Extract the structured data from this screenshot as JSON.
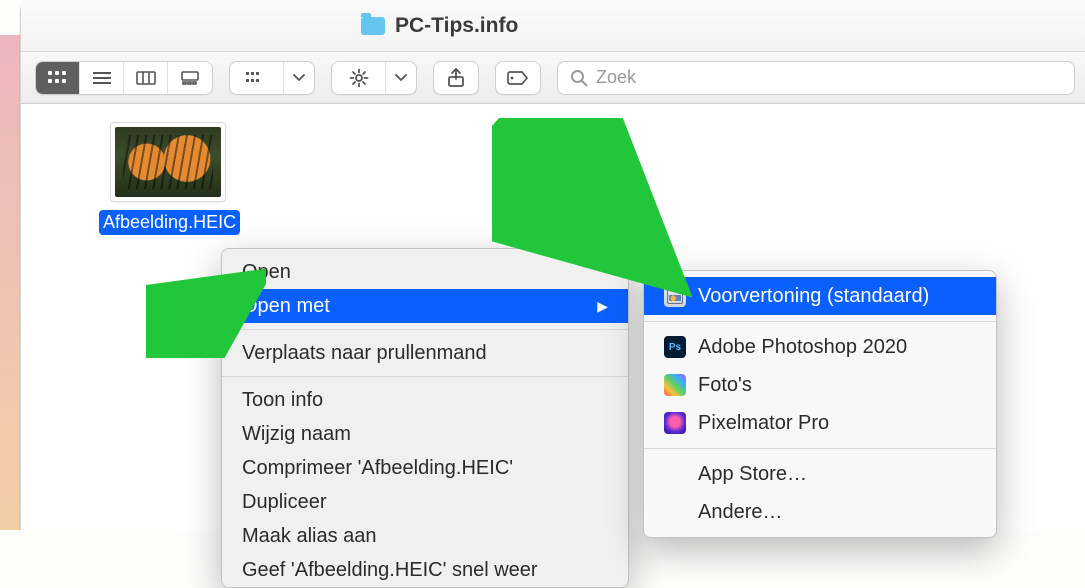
{
  "window": {
    "title": "PC-Tips.info"
  },
  "search": {
    "placeholder": "Zoek"
  },
  "file": {
    "name": "Afbeelding.HEIC"
  },
  "context_menu": {
    "items": [
      {
        "label": "Open"
      },
      {
        "label": "Open met",
        "highlighted": true,
        "has_submenu": true
      },
      null,
      {
        "label": "Verplaats naar prullenmand"
      },
      null,
      {
        "label": "Toon info"
      },
      {
        "label": "Wijzig naam"
      },
      {
        "label": "Comprimeer 'Afbeelding.HEIC'"
      },
      {
        "label": "Dupliceer"
      },
      {
        "label": "Maak alias aan"
      },
      {
        "label": "Geef 'Afbeelding.HEIC' snel weer"
      }
    ]
  },
  "submenu": {
    "items": [
      {
        "label": "Voorvertoning (standaard)",
        "highlighted": true,
        "icon": "preview"
      },
      null,
      {
        "label": "Adobe Photoshop 2020",
        "icon": "ps"
      },
      {
        "label": "Foto's",
        "icon": "fotos"
      },
      {
        "label": "Pixelmator Pro",
        "icon": "pm"
      },
      null,
      {
        "label": "App Store…"
      },
      {
        "label": "Andere…"
      }
    ]
  },
  "annotations": {
    "arrow_color": "#21c63a"
  }
}
